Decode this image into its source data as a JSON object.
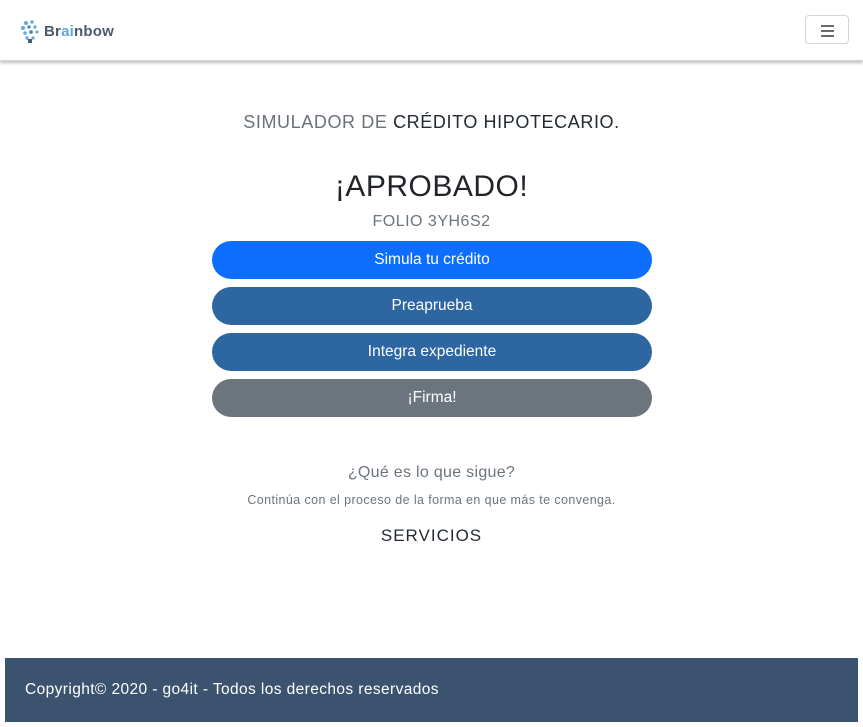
{
  "header": {
    "brand": {
      "text_start": "Br",
      "text_highlight": "ai",
      "text_end": "nbow",
      "logo_icon": "brain-icon"
    },
    "menu_icon": "hamburger-menu-icon"
  },
  "main": {
    "title_light": "SIMULADOR DE ",
    "title_dark": "CRÉDITO HIPOTECARIO.",
    "status": "¡APROBADO!",
    "folio": "FOLIO 3YH6S2",
    "steps": [
      {
        "label": "Simula tu crédito",
        "color": "#0d6efd"
      },
      {
        "label": "Preaprueba",
        "color": "#2d66a0"
      },
      {
        "label": "Integra expediente",
        "color": "#2d66a0"
      },
      {
        "label": "¡Firma!",
        "color": "#6c757d"
      }
    ],
    "next_question": "¿Qué es lo que sigue?",
    "next_description": "Continúa con el proceso de la forma en que más te convenga.",
    "services": "SERVICIOS"
  },
  "footer": {
    "text": "Copyright© 2020 - go4it - Todos los derechos reservados",
    "background": "#3b536e"
  }
}
